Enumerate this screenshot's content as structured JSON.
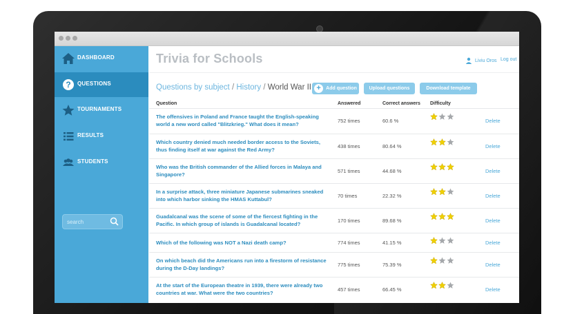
{
  "app": {
    "title": "Trivia for Schools"
  },
  "user": {
    "name": "Liviu Oros",
    "logout": "Log out"
  },
  "sidebar": {
    "items": [
      {
        "label": "DASHBOARD",
        "icon": "home-icon",
        "active": false
      },
      {
        "label": "QUESTIONS",
        "icon": "question-icon",
        "active": true
      },
      {
        "label": "TOURNAMENTS",
        "icon": "star-icon",
        "active": false
      },
      {
        "label": "RESULTS",
        "icon": "list-icon",
        "active": false
      },
      {
        "label": "STUDENTS",
        "icon": "users-icon",
        "active": false
      }
    ],
    "search": {
      "placeholder": "search",
      "value": ""
    }
  },
  "breadcrumb": {
    "part1": "Questions by subject",
    "sep1": " / ",
    "part2": "History",
    "sep2": " / ",
    "current": "World War II"
  },
  "actions": {
    "add": "Add question",
    "upload": "Upload questions",
    "download": "Download template"
  },
  "table": {
    "headers": {
      "question": "Question",
      "answered": "Answered",
      "correct": "Correct answers",
      "difficulty": "Difficulty"
    },
    "delete_label": "Delete",
    "rows": [
      {
        "question": "The offensives in Poland and France taught the English-speaking world a new word called \"Blitzkrieg.\" What does it mean?",
        "answered": "752 times",
        "correct": "60.6 %",
        "difficulty": 1
      },
      {
        "question": "Which country denied much needed border access to the Soviets, thus finding itself at war against the Red Army?",
        "answered": "438 times",
        "correct": "80.64 %",
        "difficulty": 2
      },
      {
        "question": "Who was the British commander of the Allied forces in Malaya and Singapore?",
        "answered": "571 times",
        "correct": "44.68 %",
        "difficulty": 3
      },
      {
        "question": "In a surprise attack, three miniature Japanese submarines sneaked into which harbor sinking the HMAS Kuttabul?",
        "answered": "70 times",
        "correct": "22.32 %",
        "difficulty": 2
      },
      {
        "question": "Guadalcanal was the scene of some of the fiercest fighting in the Pacific. In which group of islands is Guadalcanal located?",
        "answered": "170 times",
        "correct": "89.68 %",
        "difficulty": 3
      },
      {
        "question": "Which of the following was NOT a Nazi death camp?",
        "answered": "774 times",
        "correct": "41.15 %",
        "difficulty": 1
      },
      {
        "question": "On which beach did the Americans run into a firestorm of resistance during the D-Day landings?",
        "answered": "775 times",
        "correct": "75.39 %",
        "difficulty": 1
      },
      {
        "question": "At the start of the European theatre in 1939, there were already two countries at war. What were the two countries?",
        "answered": "457 times",
        "correct": "66.45 %",
        "difficulty": 2
      }
    ]
  },
  "colors": {
    "accent": "#4aa8d8",
    "sidebar": "#4aa8d8",
    "active": "#2b8cbe",
    "star_on": "#f0d000",
    "star_off": "#a5a8ab"
  }
}
